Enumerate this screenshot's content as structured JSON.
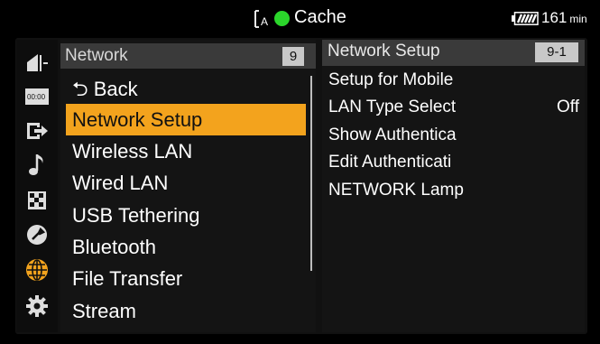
{
  "status_bar": {
    "cache_icon": "clip-a-icon",
    "cache_label": "Cache",
    "battery_icon": "battery-icon",
    "battery_remaining": "161",
    "battery_unit": "min",
    "rec_color": "#2bd62b"
  },
  "categories": [
    {
      "icon": "camera-icon"
    },
    {
      "icon": "timecode-icon"
    },
    {
      "icon": "output-icon"
    },
    {
      "icon": "music-note-icon"
    },
    {
      "icon": "checker-icon"
    },
    {
      "icon": "wrench-icon"
    },
    {
      "icon": "globe-icon",
      "active": true
    },
    {
      "icon": "gear-icon"
    }
  ],
  "menu": {
    "title": "Network",
    "page": "9",
    "items": [
      {
        "label": "⮌ Back"
      },
      {
        "label": "Network Setup",
        "selected": true
      },
      {
        "label": "Wireless LAN"
      },
      {
        "label": "Wired LAN"
      },
      {
        "label": "USB Tethering"
      },
      {
        "label": "Bluetooth"
      },
      {
        "label": "File Transfer"
      },
      {
        "label": "Stream"
      }
    ]
  },
  "detail": {
    "title": "Network Setup",
    "page": "9-1",
    "rows": [
      {
        "label": "Setup for Mobile",
        "value": ""
      },
      {
        "label": "LAN Type Select",
        "value": "Off"
      },
      {
        "label": "Show Authentica",
        "value": ""
      },
      {
        "label": "Edit Authenticati",
        "value": ""
      },
      {
        "label": "NETWORK Lamp",
        "value": ""
      }
    ]
  },
  "colors": {
    "selection": "#f3a31d",
    "globe_active": "#f3a31d"
  }
}
